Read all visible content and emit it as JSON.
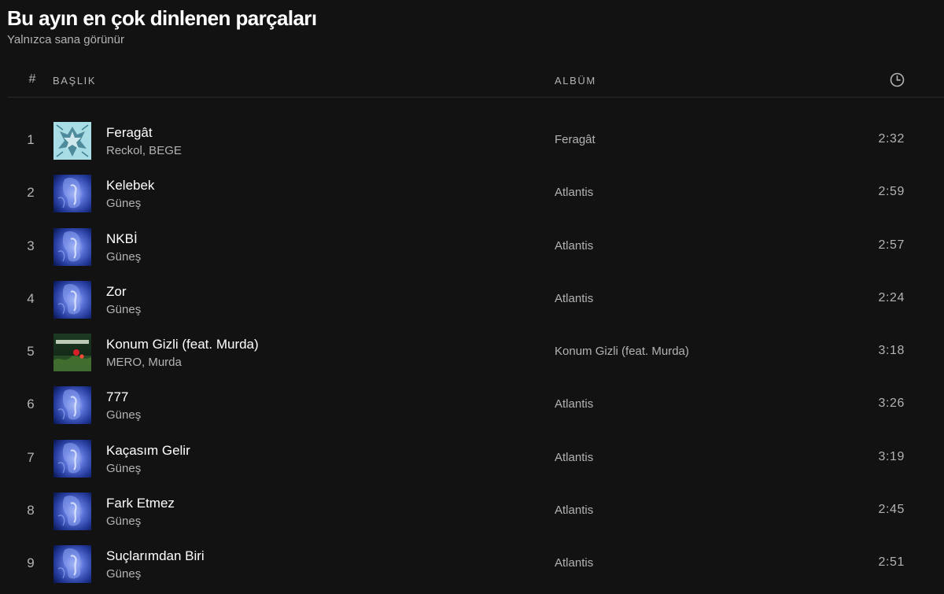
{
  "playlist": {
    "title": "Bu ayın en çok dinlenen parçaları",
    "subtitle": "Yalnızca sana görünür"
  },
  "header": {
    "number": "#",
    "title": "BAŞLIK",
    "album": "ALBÜM",
    "duration_icon": "clock-icon"
  },
  "tracks": [
    {
      "number": "1",
      "title": "Feragât",
      "artists": "Reckol, BEGE",
      "album": "Feragât",
      "duration": "2:32",
      "cover": "feragat-cover"
    },
    {
      "number": "2",
      "title": "Kelebek",
      "artists": "Güneş",
      "album": "Atlantis",
      "duration": "2:59",
      "cover": "atlantis-cover"
    },
    {
      "number": "3",
      "title": "NKBİ",
      "artists": "Güneş",
      "album": "Atlantis",
      "duration": "2:57",
      "cover": "atlantis-cover"
    },
    {
      "number": "4",
      "title": "Zor",
      "artists": "Güneş",
      "album": "Atlantis",
      "duration": "2:24",
      "cover": "atlantis-cover"
    },
    {
      "number": "5",
      "title": "Konum Gizli (feat. Murda)",
      "artists": "MERO, Murda",
      "album": "Konum Gizli (feat. Murda)",
      "duration": "3:18",
      "cover": "konum-gizli-cover"
    },
    {
      "number": "6",
      "title": "777",
      "artists": "Güneş",
      "album": "Atlantis",
      "duration": "3:26",
      "cover": "atlantis-cover"
    },
    {
      "number": "7",
      "title": "Kaçasım Gelir",
      "artists": "Güneş",
      "album": "Atlantis",
      "duration": "3:19",
      "cover": "atlantis-cover"
    },
    {
      "number": "8",
      "title": "Fark Etmez",
      "artists": "Güneş",
      "album": "Atlantis",
      "duration": "2:45",
      "cover": "atlantis-cover"
    },
    {
      "number": "9",
      "title": "Suçlarımdan Biri",
      "artists": "Güneş",
      "album": "Atlantis",
      "duration": "2:51",
      "cover": "atlantis-cover"
    }
  ],
  "colors": {
    "background": "#121212",
    "text_primary": "#ffffff",
    "text_secondary": "#b3b3b3",
    "divider": "#2a2a2a"
  }
}
